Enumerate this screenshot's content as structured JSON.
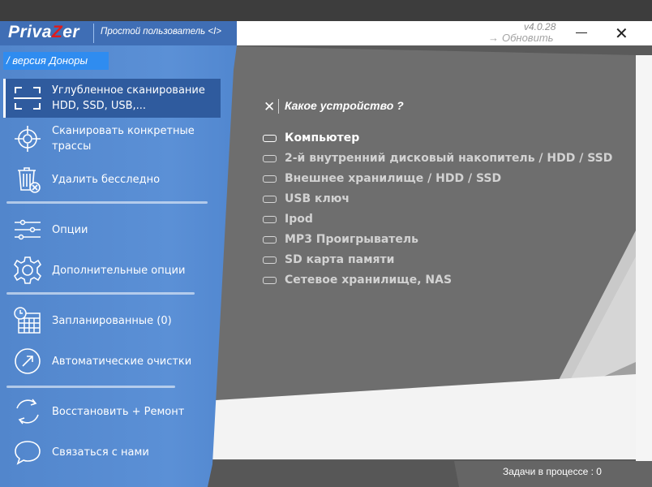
{
  "app": {
    "logo_prefix": "Priva",
    "logo_z": "Z",
    "logo_suffix": "er",
    "user_mode": "Простой пользователь <I>",
    "version_badge": "/ версия Доноры",
    "version": "v4.0.28",
    "update_label": "Обновить",
    "update_arrow": "→",
    "close_glyph": "✕"
  },
  "sidebar": {
    "items": [
      {
        "line1": "Углубленное сканирование",
        "line2": "HDD, SSD, USB,...",
        "icon": "scan-frame-icon"
      },
      {
        "line1": "Сканировать конкретные",
        "line2": "трассы",
        "icon": "crosshair-icon"
      },
      {
        "line1": "Удалить бесследно",
        "icon": "trash-delete-icon"
      },
      {
        "line1": "Опции",
        "icon": "sliders-icon"
      },
      {
        "line1": "Дополнительные опции",
        "icon": "gear-icon"
      },
      {
        "line1": "Запланированные (0)",
        "icon": "calendar-clock-icon"
      },
      {
        "line1": "Автоматические очистки",
        "icon": "auto-arrow-circle-icon"
      },
      {
        "line1": "Восстановить + Ремонт",
        "icon": "restore-cycle-icon"
      },
      {
        "line1": "Связаться с нами",
        "icon": "chat-bubble-icon"
      }
    ]
  },
  "main": {
    "question_close": "✕",
    "question": "Какое устройство ?",
    "options": [
      {
        "label": "Компьютер",
        "selected": true
      },
      {
        "label": "2-й внутренний дисковый накопитель / HDD / SSD"
      },
      {
        "label": "Внешнее хранилище  / HDD / SSD"
      },
      {
        "label": "USB ключ"
      },
      {
        "label": "Ipod"
      },
      {
        "label": "MP3 Проигрыватель"
      },
      {
        "label": "SD карта памяти"
      },
      {
        "label": "Сетевое хранилище, NAS"
      }
    ]
  },
  "status": {
    "tasks": "Задачи в процессе : 0"
  },
  "colors": {
    "sidebar": "#5b90d6",
    "active_item": "#2f5b9e",
    "badge": "#2f8cf0",
    "logo_accent": "#e11b1b"
  }
}
